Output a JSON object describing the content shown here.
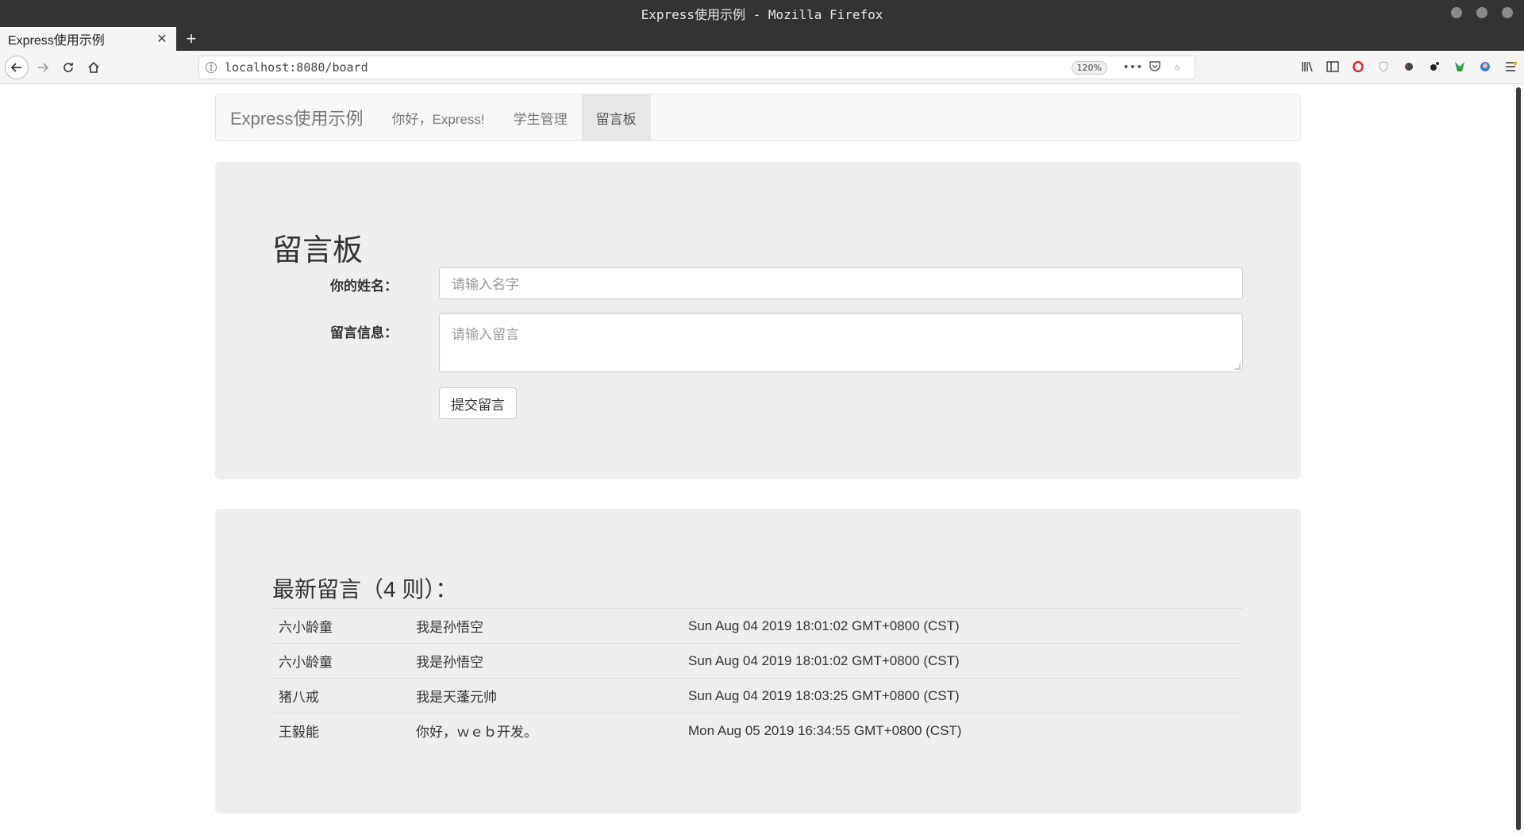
{
  "window": {
    "title": "Express使用示例 - Mozilla Firefox"
  },
  "tabs": [
    {
      "label": "Express使用示例",
      "close_icon": "close-icon"
    }
  ],
  "address_bar": {
    "url": "localhost:8080/board",
    "zoom": "120%"
  },
  "site_nav": {
    "brand": "Express使用示例",
    "links": [
      {
        "label": "你好，Express!",
        "active": false
      },
      {
        "label": "学生管理",
        "active": false
      },
      {
        "label": "留言板",
        "active": true
      }
    ]
  },
  "board_form": {
    "title": "留言板",
    "name_label": "你的姓名：",
    "name_placeholder": "请输入名字",
    "message_label": "留言信息：",
    "message_placeholder": "请输入留言",
    "submit_label": "提交留言"
  },
  "messages_section": {
    "title": "最新留言（4 则）：",
    "rows": [
      {
        "name": "六小龄童",
        "content": "我是孙悟空",
        "time": "Sun Aug 04 2019 18:01:02 GMT+0800 (CST)"
      },
      {
        "name": "六小龄童",
        "content": "我是孙悟空",
        "time": "Sun Aug 04 2019 18:01:02 GMT+0800 (CST)"
      },
      {
        "name": "猪八戒",
        "content": "我是天蓬元帅",
        "time": "Sun Aug 04 2019 18:03:25 GMT+0800 (CST)"
      },
      {
        "name": "王毅能",
        "content": "你好，ｗｅｂ开发。",
        "time": "Mon Aug 05 2019 16:34:55 GMT+0800 (CST)"
      }
    ]
  }
}
